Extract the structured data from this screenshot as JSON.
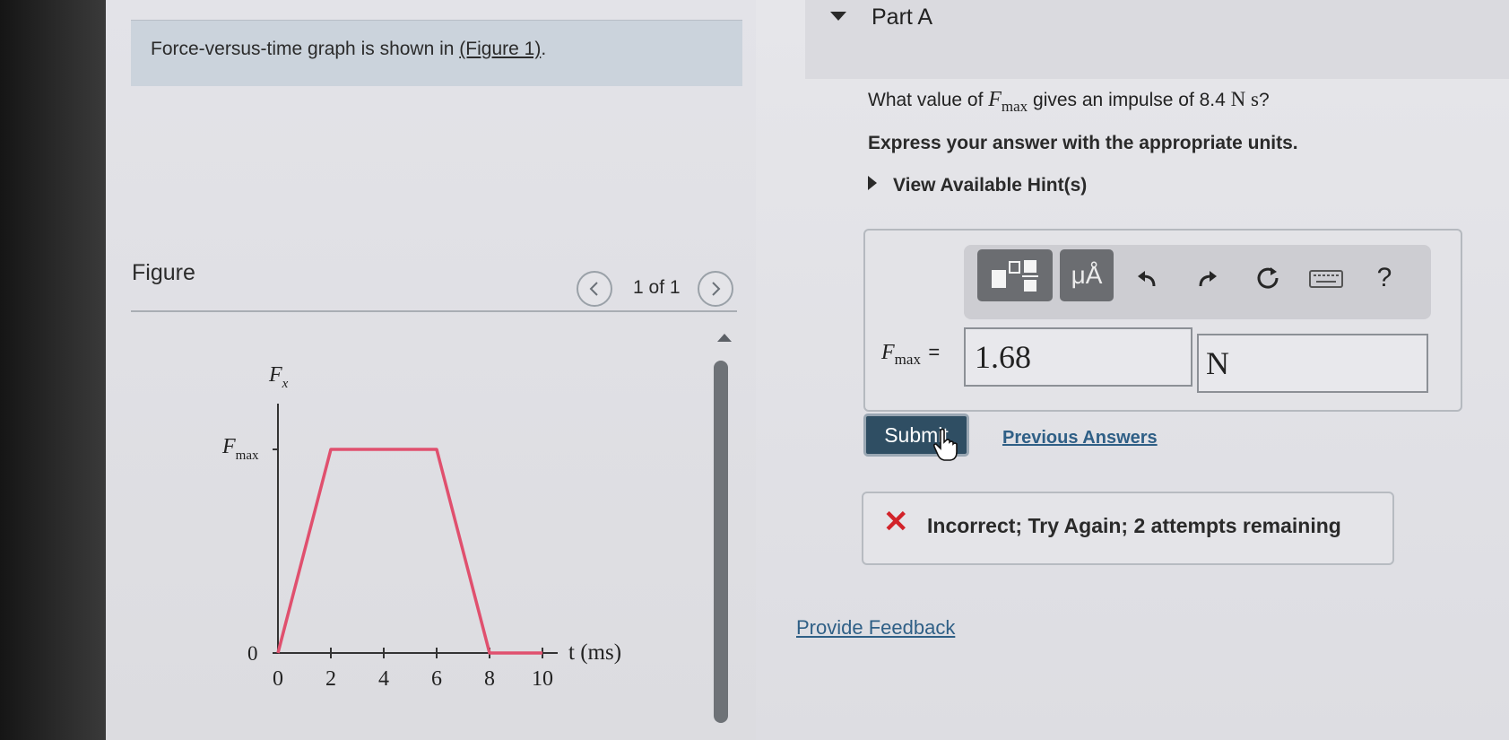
{
  "intro": {
    "text": "Force-versus-time graph is shown in ",
    "link": "(Figure 1)",
    "suffix": "."
  },
  "figure": {
    "label": "Figure",
    "pager": "1 of 1",
    "prev_icon": "chevron-left-icon",
    "next_icon": "chevron-right-icon"
  },
  "chart_data": {
    "type": "line",
    "series": [
      {
        "name": "",
        "x": [
          0,
          2,
          6,
          8,
          10
        ],
        "y": [
          "0",
          "Fmax",
          "Fmax",
          "0",
          "0"
        ]
      }
    ],
    "ylabel_main": "F",
    "ylabel_sub": "x",
    "ytick_sym_main": "F",
    "ytick_sym_sub": "max",
    "ytick_zero": "0",
    "xlabel": "t (ms)",
    "xticks": [
      "0",
      "2",
      "4",
      "6",
      "8",
      "10"
    ],
    "xlim": [
      0,
      10
    ],
    "line_color": "#e0506e"
  },
  "part": {
    "title": "Part A",
    "q_prefix": "What value of ",
    "q_var": "F",
    "q_sub": "max",
    "q_middle": " gives an impulse of 8.4 ",
    "q_unit": "N s",
    "q_suffix": "?",
    "instruction": "Express your answer with the appropriate units.",
    "hint": "View Available Hint(s)"
  },
  "toolbar": {
    "templates_icon": "fraction-template-icon",
    "units_label": "μÅ",
    "undo_icon": "undo-icon",
    "redo_icon": "redo-icon",
    "reset_icon": "reset-icon",
    "keyboard_icon": "keyboard-icon",
    "help_label": "?"
  },
  "answer": {
    "var": "F",
    "sub": "max",
    "equals": "=",
    "value": "1.68",
    "unit": "N"
  },
  "actions": {
    "submit": "Submit",
    "previous": "Previous Answers"
  },
  "feedback": {
    "icon": "x-icon",
    "text": "Incorrect; Try Again; 2 attempts remaining",
    "color": "#d2232a"
  },
  "provide_feedback": "Provide Feedback"
}
